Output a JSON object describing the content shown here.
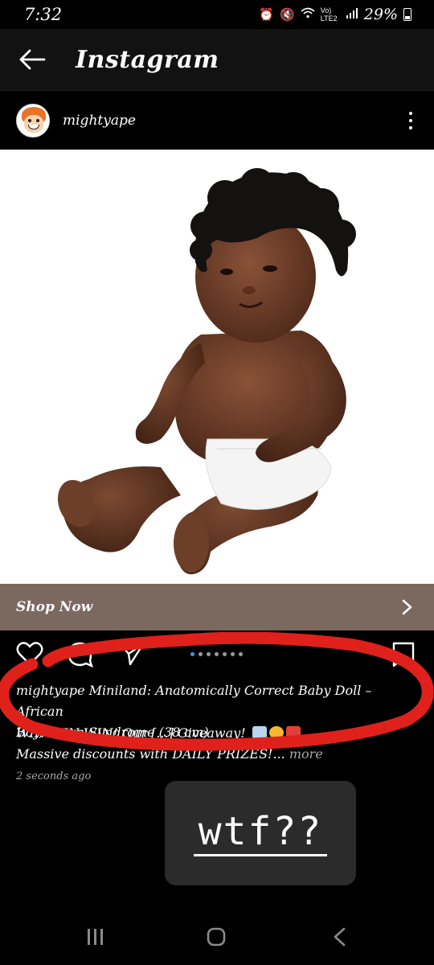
{
  "status_bar": {
    "time": "7:32",
    "network": "Vo) LTE2",
    "battery": "29%"
  },
  "header": {
    "title": "Instagram"
  },
  "post": {
    "username": "mightyape",
    "shop_now_label": "Shop Now",
    "caption_user": "mightyape",
    "caption_line1": "Miniland: Anatomically Correct Baby Doll – African",
    "caption_line2": "Boy, Down Syndrome (38 cm)",
    "caption_line3": "WIN WIN WIN! Our [...] Giveaway!",
    "caption_line4": "Massive discounts with DAILY PRIZES!...",
    "more_label": "more",
    "timestamp": "2 seconds ago",
    "carousel_count": 7,
    "carousel_active": 1
  },
  "sticker": {
    "text": "wtf??"
  },
  "colors": {
    "shop_bar": "#7b685f",
    "marker_red": "#e0201b",
    "carousel_active": "#3897f0"
  },
  "icons": [
    "back-arrow-icon",
    "more-vertical-icon",
    "chevron-right-icon",
    "heart-icon",
    "comment-icon",
    "share-icon",
    "bookmark-icon",
    "recents-icon",
    "home-icon",
    "back-nav-icon"
  ]
}
